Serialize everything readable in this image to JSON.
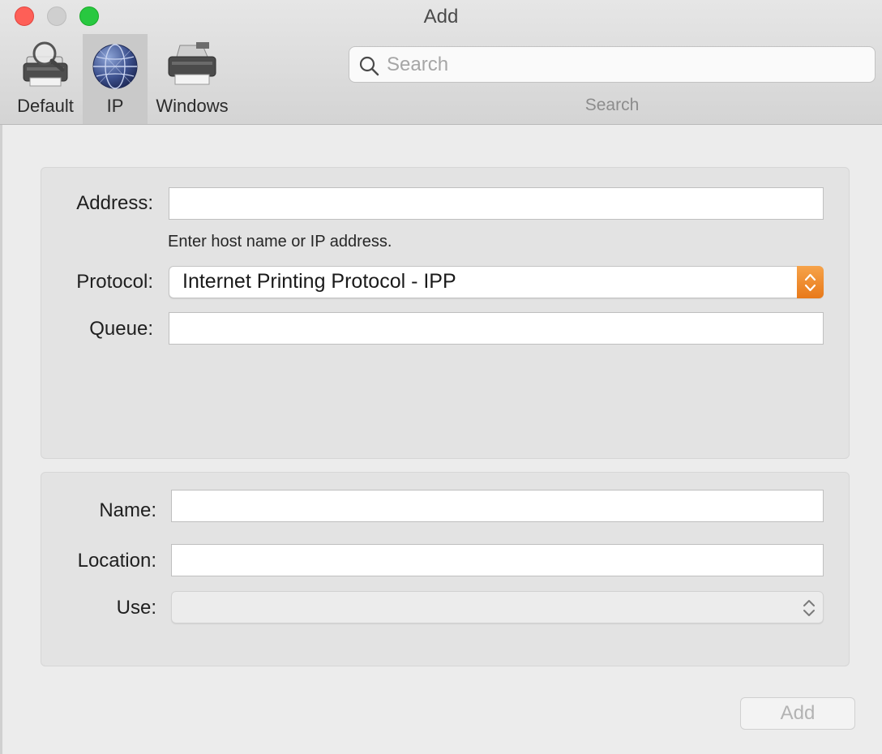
{
  "window": {
    "title": "Add"
  },
  "toolbar": {
    "tabs": [
      {
        "label": "Default",
        "icon": "printer-magnifier-icon"
      },
      {
        "label": "IP",
        "icon": "globe-icon",
        "selected": true
      },
      {
        "label": "Windows",
        "icon": "printer-icon"
      }
    ],
    "search": {
      "placeholder": "Search",
      "value": "",
      "caption": "Search"
    }
  },
  "connection": {
    "address_label": "Address:",
    "address_value": "",
    "address_hint": "Enter host name or IP address.",
    "protocol_label": "Protocol:",
    "protocol_value": "Internet Printing Protocol - IPP",
    "queue_label": "Queue:",
    "queue_value": ""
  },
  "printer": {
    "name_label": "Name:",
    "name_value": "",
    "location_label": "Location:",
    "location_value": "",
    "use_label": "Use:",
    "use_value": ""
  },
  "footer": {
    "add_label": "Add"
  },
  "colors": {
    "accent_orange": "#e8791a",
    "close": "#fe5f57",
    "zoom": "#28c840"
  }
}
